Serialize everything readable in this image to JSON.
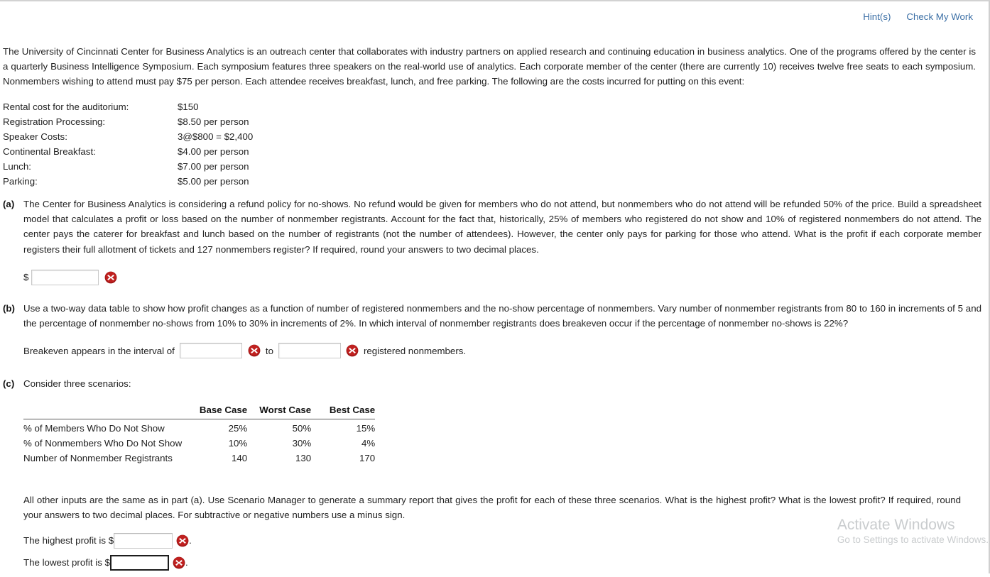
{
  "toolbar": {
    "hints_label": "Hint(s)",
    "check_label": "Check My Work",
    "link_color": "#3a6ea5"
  },
  "intro": {
    "text": "The University of Cincinnati Center for Business Analytics is an outreach center that collaborates with industry partners on applied research and continuing education in business analytics. One of the programs offered by the center is a quarterly Business Intelligence Symposium. Each symposium features three speakers on the real-world use of analytics. Each corporate member of the center (there are currently 10) receives twelve free seats to each symposium. Nonmembers wishing to attend must pay $75 per person. Each attendee receives breakfast, lunch, and free parking. The following are the costs incurred for putting on this event:"
  },
  "costs": [
    {
      "label": "Rental cost for the auditorium:",
      "value": "$150"
    },
    {
      "label": "Registration Processing:",
      "value": "$8.50 per person"
    },
    {
      "label": "Speaker Costs:",
      "value": "3@$800 = $2,400"
    },
    {
      "label": "Continental Breakfast:",
      "value": "$4.00 per person"
    },
    {
      "label": "Lunch:",
      "value": "$7.00 per person"
    },
    {
      "label": "Parking:",
      "value": "$5.00 per person"
    }
  ],
  "parts": {
    "a": {
      "marker": "(a)",
      "text": "The Center for Business Analytics is considering a refund policy for no-shows. No refund would be given for members who do not attend, but nonmembers who do not attend will be refunded 50% of the price. Build a spreadsheet model that calculates a profit or loss based on the number of nonmember registrants. Account for the fact that, historically, 25% of members who registered do not show and 10% of registered nonmembers do not attend. The center pays the caterer for breakfast and lunch based on the number of registrants (not the number of attendees). However, the center only pays for parking for those who attend. What is the profit if each corporate member registers their full allotment of tickets and 127 nonmembers register? If required, round your answers to two decimal places.",
      "dollar_sign": "$",
      "answer_value": "",
      "answer_placeholder": "",
      "error_icon": "error-x-icon"
    },
    "b": {
      "marker": "(b)",
      "text": "Use a two-way data table to show how profit changes as a function of number of registered nonmembers and the no-show percentage of nonmembers. Vary number of nonmember registrants from 80 to 160 in increments of 5 and the percentage of nonmember no-shows from 10% to 30% in increments of 2%. In which interval of nonmember registrants does breakeven occur if the percentage of nonmember no-shows is 22%?",
      "prefix": "Breakeven appears in the interval of",
      "middle": "to",
      "suffix": "registered nonmembers.",
      "from_value": "",
      "to_value": "",
      "error_icon": "error-x-icon"
    },
    "c": {
      "marker": "(c)",
      "text": "Consider three scenarios:",
      "table": {
        "columns": [
          "",
          "Base Case",
          "Worst Case",
          "Best Case"
        ],
        "rows": [
          {
            "label": "% of Members Who Do Not Show",
            "values": [
              "25%",
              "50%",
              "15%"
            ]
          },
          {
            "label": "% of Nonmembers Who Do Not Show",
            "values": [
              "10%",
              "30%",
              "4%"
            ]
          },
          {
            "label": "Number of Nonmember Registrants",
            "values": [
              "140",
              "130",
              "170"
            ]
          }
        ]
      },
      "closing_text": "All other inputs are the same as in part (a). Use Scenario Manager to generate a summary report that gives the profit for each of these three scenarios. What is the highest profit? What is the lowest profit? If required, round your answers to two decimal places. For subtractive or negative numbers use a minus sign.",
      "highest_prefix": "The highest profit is $",
      "highest_value": "",
      "highest_suffix": ".",
      "lowest_prefix": "The lowest profit is $",
      "lowest_value": "",
      "lowest_suffix": ".",
      "error_icon": "error-x-icon"
    }
  },
  "watermark": {
    "line1": "Activate Windows",
    "line2": "Go to Settings to activate Windows."
  }
}
